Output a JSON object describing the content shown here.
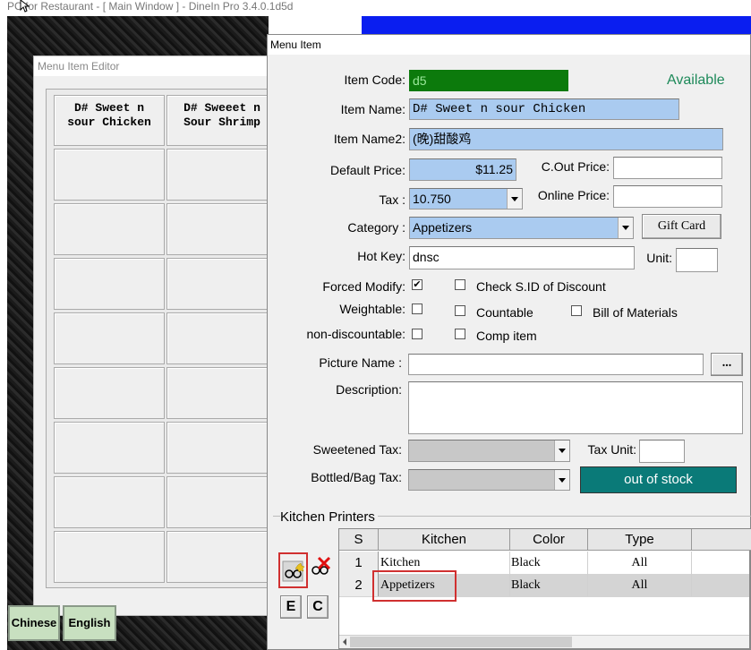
{
  "main_window": {
    "title": "PC for Restaurant - [ Main Window ] - DineIn Pro 3.4.0.1d5d"
  },
  "editor": {
    "title": "Menu Item Editor",
    "items": [
      "D# Sweet n\nsour Chicken",
      "D# Sweeet n\nSour Shrimp"
    ],
    "lang_buttons": [
      "Chinese",
      "English"
    ]
  },
  "dialog": {
    "title": "Menu Item",
    "status": "Available",
    "status_color": "#1e8a5a",
    "labels": {
      "item_code": "Item Code:",
      "item_name": "Item Name:",
      "item_name2": "Item Name2:",
      "default_price": "Default Price:",
      "cout_price": "C.Out Price:",
      "tax": "Tax :",
      "online_price": "Online Price:",
      "category": "Category :",
      "hot_key": "Hot Key:",
      "unit": "Unit:",
      "forced_modify": "Forced Modify:",
      "weightable": "Weightable:",
      "non_discountable": "non-discountable:",
      "check_sid": "Check S.ID of Discount",
      "countable": "Countable",
      "comp_item": "Comp item",
      "bill_of_materials": "Bill of Materials",
      "picture_name": "Picture Name :",
      "description": "Description:",
      "sweetened_tax": "Sweetened  Tax:",
      "tax_unit": "Tax Unit:",
      "bottled_tax": "Bottled/Bag Tax:"
    },
    "values": {
      "item_code": "d5",
      "item_name": "D# Sweet n sour Chicken",
      "item_name2": "(晚)甜酸鸡",
      "default_price": "$11.25",
      "cout_price": "",
      "tax": "10.750",
      "online_price": "",
      "category": "Appetizers",
      "hot_key": "dnsc",
      "unit": "",
      "picture_name": "",
      "description": "",
      "sweetened_tax": "",
      "tax_unit": "",
      "bottled_tax": ""
    },
    "checks": {
      "forced_modify": "✔"
    },
    "buttons": {
      "gift_card": "Gift Card",
      "browse": "...",
      "out_of_stock": "out of stock",
      "e": "E",
      "c": "C"
    },
    "colors": {
      "item_code_bg": "#0c7a0c",
      "out_of_stock_bg": "#0a7a78",
      "field_blue": "#aacbf0"
    }
  },
  "kitchen_printers": {
    "title": "Kitchen Printers",
    "columns": [
      "S",
      "Kitchen",
      "Color",
      "Type"
    ],
    "rows": [
      {
        "s": "1",
        "kitchen": "Kitchen",
        "color": "Black",
        "type": "All"
      },
      {
        "s": "2",
        "kitchen": "Appetizers",
        "color": "Black",
        "type": "All"
      }
    ]
  }
}
